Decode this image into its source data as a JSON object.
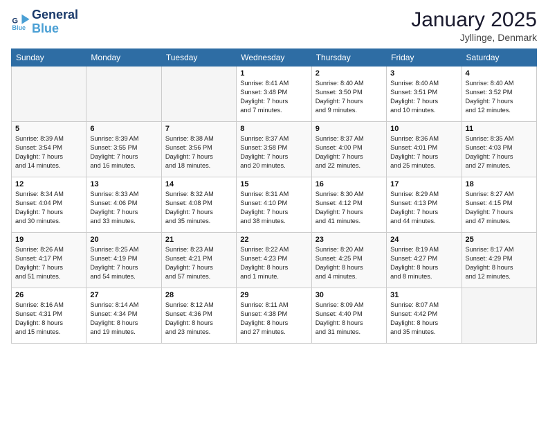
{
  "logo": {
    "line1": "General",
    "line2": "Blue"
  },
  "title": "January 2025",
  "location": "Jyllinge, Denmark",
  "days_header": [
    "Sunday",
    "Monday",
    "Tuesday",
    "Wednesday",
    "Thursday",
    "Friday",
    "Saturday"
  ],
  "weeks": [
    [
      {
        "day": "",
        "info": ""
      },
      {
        "day": "",
        "info": ""
      },
      {
        "day": "",
        "info": ""
      },
      {
        "day": "1",
        "info": "Sunrise: 8:41 AM\nSunset: 3:48 PM\nDaylight: 7 hours\nand 7 minutes."
      },
      {
        "day": "2",
        "info": "Sunrise: 8:40 AM\nSunset: 3:50 PM\nDaylight: 7 hours\nand 9 minutes."
      },
      {
        "day": "3",
        "info": "Sunrise: 8:40 AM\nSunset: 3:51 PM\nDaylight: 7 hours\nand 10 minutes."
      },
      {
        "day": "4",
        "info": "Sunrise: 8:40 AM\nSunset: 3:52 PM\nDaylight: 7 hours\nand 12 minutes."
      }
    ],
    [
      {
        "day": "5",
        "info": "Sunrise: 8:39 AM\nSunset: 3:54 PM\nDaylight: 7 hours\nand 14 minutes."
      },
      {
        "day": "6",
        "info": "Sunrise: 8:39 AM\nSunset: 3:55 PM\nDaylight: 7 hours\nand 16 minutes."
      },
      {
        "day": "7",
        "info": "Sunrise: 8:38 AM\nSunset: 3:56 PM\nDaylight: 7 hours\nand 18 minutes."
      },
      {
        "day": "8",
        "info": "Sunrise: 8:37 AM\nSunset: 3:58 PM\nDaylight: 7 hours\nand 20 minutes."
      },
      {
        "day": "9",
        "info": "Sunrise: 8:37 AM\nSunset: 4:00 PM\nDaylight: 7 hours\nand 22 minutes."
      },
      {
        "day": "10",
        "info": "Sunrise: 8:36 AM\nSunset: 4:01 PM\nDaylight: 7 hours\nand 25 minutes."
      },
      {
        "day": "11",
        "info": "Sunrise: 8:35 AM\nSunset: 4:03 PM\nDaylight: 7 hours\nand 27 minutes."
      }
    ],
    [
      {
        "day": "12",
        "info": "Sunrise: 8:34 AM\nSunset: 4:04 PM\nDaylight: 7 hours\nand 30 minutes."
      },
      {
        "day": "13",
        "info": "Sunrise: 8:33 AM\nSunset: 4:06 PM\nDaylight: 7 hours\nand 33 minutes."
      },
      {
        "day": "14",
        "info": "Sunrise: 8:32 AM\nSunset: 4:08 PM\nDaylight: 7 hours\nand 35 minutes."
      },
      {
        "day": "15",
        "info": "Sunrise: 8:31 AM\nSunset: 4:10 PM\nDaylight: 7 hours\nand 38 minutes."
      },
      {
        "day": "16",
        "info": "Sunrise: 8:30 AM\nSunset: 4:12 PM\nDaylight: 7 hours\nand 41 minutes."
      },
      {
        "day": "17",
        "info": "Sunrise: 8:29 AM\nSunset: 4:13 PM\nDaylight: 7 hours\nand 44 minutes."
      },
      {
        "day": "18",
        "info": "Sunrise: 8:27 AM\nSunset: 4:15 PM\nDaylight: 7 hours\nand 47 minutes."
      }
    ],
    [
      {
        "day": "19",
        "info": "Sunrise: 8:26 AM\nSunset: 4:17 PM\nDaylight: 7 hours\nand 51 minutes."
      },
      {
        "day": "20",
        "info": "Sunrise: 8:25 AM\nSunset: 4:19 PM\nDaylight: 7 hours\nand 54 minutes."
      },
      {
        "day": "21",
        "info": "Sunrise: 8:23 AM\nSunset: 4:21 PM\nDaylight: 7 hours\nand 57 minutes."
      },
      {
        "day": "22",
        "info": "Sunrise: 8:22 AM\nSunset: 4:23 PM\nDaylight: 8 hours\nand 1 minute."
      },
      {
        "day": "23",
        "info": "Sunrise: 8:20 AM\nSunset: 4:25 PM\nDaylight: 8 hours\nand 4 minutes."
      },
      {
        "day": "24",
        "info": "Sunrise: 8:19 AM\nSunset: 4:27 PM\nDaylight: 8 hours\nand 8 minutes."
      },
      {
        "day": "25",
        "info": "Sunrise: 8:17 AM\nSunset: 4:29 PM\nDaylight: 8 hours\nand 12 minutes."
      }
    ],
    [
      {
        "day": "26",
        "info": "Sunrise: 8:16 AM\nSunset: 4:31 PM\nDaylight: 8 hours\nand 15 minutes."
      },
      {
        "day": "27",
        "info": "Sunrise: 8:14 AM\nSunset: 4:34 PM\nDaylight: 8 hours\nand 19 minutes."
      },
      {
        "day": "28",
        "info": "Sunrise: 8:12 AM\nSunset: 4:36 PM\nDaylight: 8 hours\nand 23 minutes."
      },
      {
        "day": "29",
        "info": "Sunrise: 8:11 AM\nSunset: 4:38 PM\nDaylight: 8 hours\nand 27 minutes."
      },
      {
        "day": "30",
        "info": "Sunrise: 8:09 AM\nSunset: 4:40 PM\nDaylight: 8 hours\nand 31 minutes."
      },
      {
        "day": "31",
        "info": "Sunrise: 8:07 AM\nSunset: 4:42 PM\nDaylight: 8 hours\nand 35 minutes."
      },
      {
        "day": "",
        "info": ""
      }
    ]
  ]
}
